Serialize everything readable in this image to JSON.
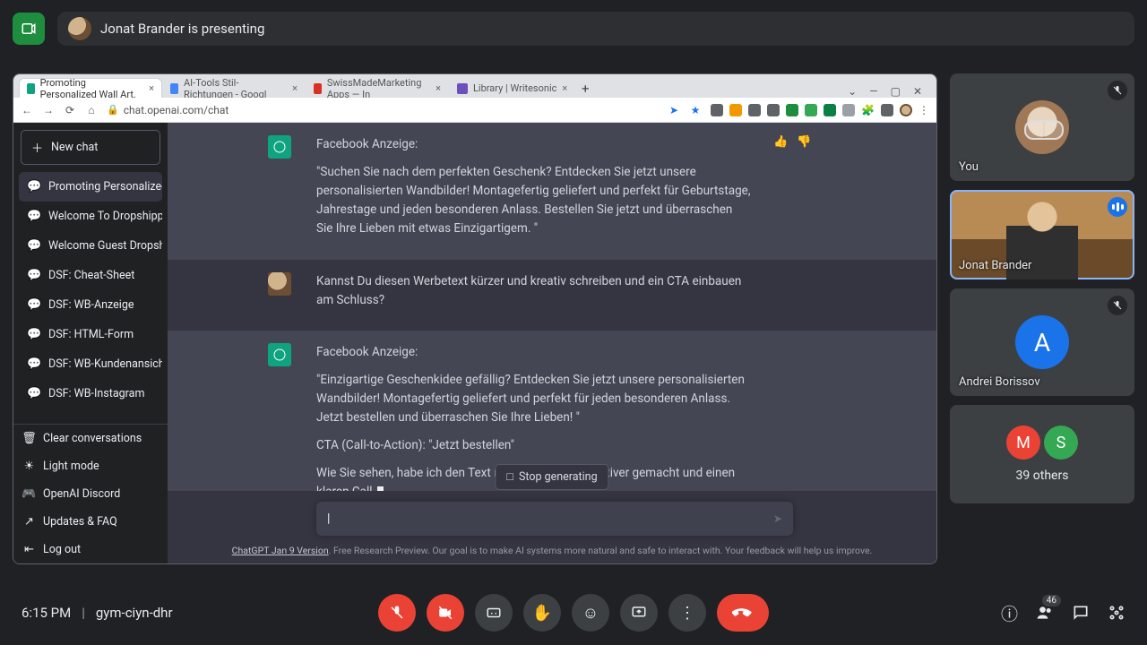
{
  "meet": {
    "presenter_name": "Jonat Brander",
    "presenting_text": "Jonat Brander is presenting",
    "time": "6:15 PM",
    "code": "gym-ciyn-dhr",
    "participant_count_badge": "46",
    "tiles": {
      "you": {
        "label": "You"
      },
      "presenter": {
        "label": "Jonat Brander"
      },
      "p3": {
        "label": "Andrei Borissov",
        "initial": "A",
        "color": "#1a73e8"
      },
      "others_label": "39 others",
      "others_avatars": [
        {
          "initial": "M",
          "color": "#ea4335"
        },
        {
          "initial": "S",
          "color": "#34a853"
        }
      ]
    }
  },
  "chrome": {
    "tabs": [
      {
        "title": "Promoting Personalized Wall Art.",
        "active": true,
        "fav": "#10a37f"
      },
      {
        "title": "AI-Tools Stil-Richtungen - Googl",
        "active": false,
        "fav": "#4285f4"
      },
      {
        "title": "SwissMadeMarketing Apps — In",
        "active": false,
        "fav": "#d93025"
      },
      {
        "title": "Library | Writesonic",
        "active": false,
        "fav": "#6b4fbb"
      }
    ],
    "url": "chat.openai.com/chat",
    "ext_colors": [
      "#4285f4",
      "#5f6368",
      "#5f6368",
      "#f29900",
      "#5f6368",
      "#1e8e3e",
      "#34a853",
      "#0b8043",
      "#9aa0a6",
      "#5f6368",
      "#5f6368"
    ]
  },
  "chatgpt": {
    "new_chat": "New chat",
    "chats": [
      {
        "title": "Promoting Personalized",
        "active": true
      },
      {
        "title": "Welcome To Dropshipping Liv",
        "active": false
      },
      {
        "title": "Welcome Guest Dropshipping",
        "active": false
      },
      {
        "title": "DSF: Cheat-Sheet",
        "active": false
      },
      {
        "title": "DSF: WB-Anzeige",
        "active": false
      },
      {
        "title": "DSF: HTML-Form",
        "active": false
      },
      {
        "title": "DSF: WB-Kundenansicht",
        "active": false
      },
      {
        "title": "DSF: WB-Instagram",
        "active": false
      }
    ],
    "footer": {
      "clear": "Clear conversations",
      "light": "Light mode",
      "discord": "OpenAI Discord",
      "updates": "Updates & FAQ",
      "logout": "Log out"
    },
    "messages": {
      "m1_title": "Facebook Anzeige:",
      "m1_body": "\"Suchen Sie nach dem perfekten Geschenk? Entdecken Sie jetzt unsere personalisierten Wandbilder! Montagefertig geliefert und perfekt für Geburtstage, Jahrestage und jeden besonderen Anlass. Bestellen Sie jetzt und überraschen Sie Ihre Lieben mit etwas Einzigartigem. \"",
      "m2": "Kannst Du diesen Werbetext kürzer und kreativ schreiben und ein CTA einbauen am Schluss?",
      "m3_title": "Facebook Anzeige:",
      "m3_p1": "\"Einzigartige Geschenkidee gefällig? Entdecken Sie jetzt unsere personalisierten Wandbilder! Montagefertig geliefert und perfekt für jeden besonderen Anlass. Jetzt bestellen und überraschen Sie Ihre Lieben! \"",
      "m3_p2": "CTA (Call-to-Action): \"Jetzt bestellen\"",
      "m3_p3": "Wie Sie sehen, habe ich den Text noch kürzer und kreativer gemacht und einen klaren Call-"
    },
    "stop": "Stop generating",
    "placeholder": "",
    "disclaimer_link": "ChatGPT Jan 9 Version",
    "disclaimer_rest": ". Free Research Preview. Our goal is to make AI systems more natural and safe to interact with. Your feedback will help us improve."
  }
}
